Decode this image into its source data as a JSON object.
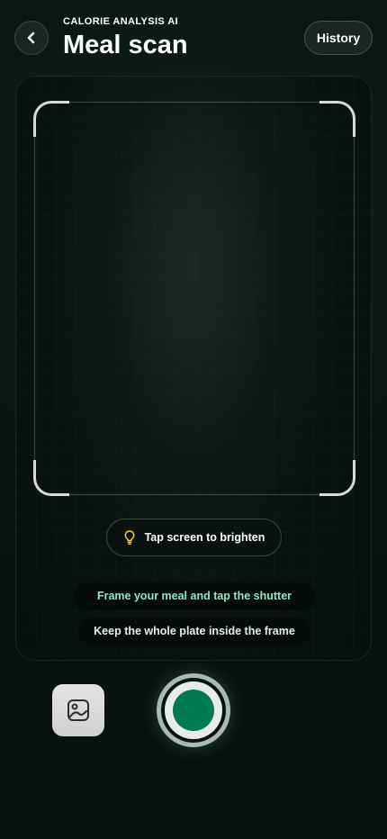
{
  "header": {
    "eyebrow": "CALORIE ANALYSIS AI",
    "title": "Meal scan",
    "history_label": "History",
    "back_icon": "chevron-left-icon"
  },
  "camera": {
    "brighten_label": "Tap screen to brighten",
    "brighten_icon": "lightbulb-icon",
    "tips": [
      "Frame your meal and tap the shutter",
      "Keep the whole plate inside the frame"
    ]
  },
  "controls": {
    "gallery_icon": "image-icon",
    "shutter_icon": "shutter-button"
  },
  "colors": {
    "accent": "#007a52",
    "tip_highlight": "#8de8c4",
    "bulb": "#f2c84b"
  }
}
